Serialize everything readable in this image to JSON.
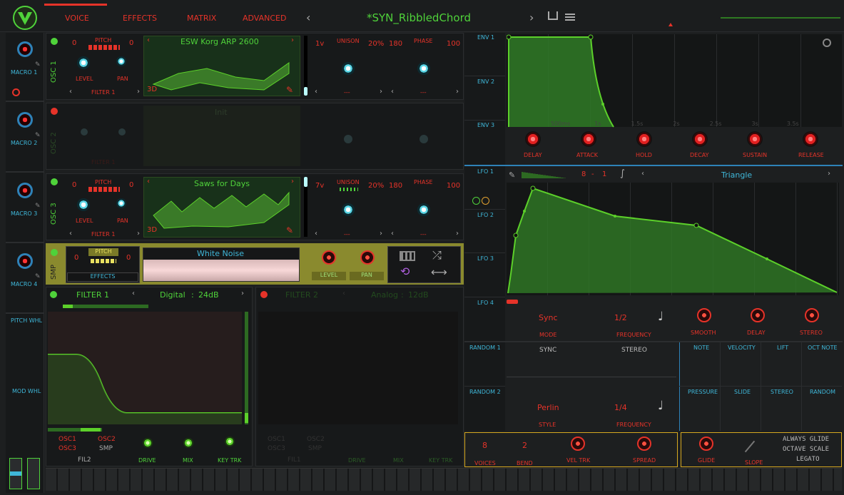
{
  "nav": {
    "tabs": [
      "VOICE",
      "EFFECTS",
      "MATRIX",
      "ADVANCED"
    ],
    "preset": "*SYN_RibbledChord"
  },
  "macros": [
    "MACRO 1",
    "MACRO 2",
    "MACRO 3",
    "MACRO 4"
  ],
  "wheels": {
    "pitch": "PITCH WHL",
    "mod": "MOD WHL"
  },
  "osc": [
    {
      "label": "OSC 1",
      "wave": "ESW Korg ARP 2600",
      "voices": "1v",
      "unison_pct": "20%",
      "unison_val": "180",
      "phase_val": "100",
      "pitch_l": "0",
      "pitch_r": "0",
      "filter": "FILTER 1",
      "dash1": "---",
      "dash2": "---"
    },
    {
      "label": "OSC 2",
      "wave": "Init",
      "filter": "FILTER 1"
    },
    {
      "label": "OSC 3",
      "wave": "Saws for Days",
      "voices": "7v",
      "unison_pct": "20%",
      "unison_val": "180",
      "phase_val": "100",
      "pitch_l": "0",
      "pitch_r": "0",
      "filter": "FILTER 1",
      "dash1": "---",
      "dash2": "---"
    }
  ],
  "osc_labels": {
    "pitch": "PITCH",
    "level": "LEVEL",
    "pan": "PAN",
    "unison": "UNISON",
    "phase": "PHASE",
    "d3": "3D"
  },
  "smp": {
    "label": "SMP",
    "pitch": "PITCH",
    "effects": "EFFECTS",
    "sample": "White Noise",
    "level": "LEVEL",
    "pan": "PAN",
    "l": "0",
    "r": "0"
  },
  "filter1": {
    "name": "FILTER 1",
    "type": "Digital",
    "slope": "24dB",
    "o1": "OSC1",
    "o2": "OSC2",
    "o3": "OSC3",
    "smp": "SMP",
    "fil": "FIL2",
    "drive": "DRIVE",
    "mix": "MIX",
    "keytrk": "KEY TRK"
  },
  "filter2": {
    "name": "FILTER 2",
    "type": "Analog",
    "slope": "12dB",
    "o1": "OSC1",
    "o2": "OSC2",
    "o3": "OSC3",
    "smp": "SMP",
    "fil": "FIL1",
    "drive": "DRIVE",
    "mix": "MIX",
    "keytrk": "KEY TRK"
  },
  "env": {
    "tabs": [
      "ENV 1",
      "ENV 2",
      "ENV 3"
    ],
    "knobs": [
      "DELAY",
      "ATTACK",
      "HOLD",
      "DECAY",
      "SUSTAIN",
      "RELEASE"
    ],
    "time": [
      "500ms",
      "1s",
      "1.5s",
      "2s",
      "2.5s",
      "3s",
      "3.5s"
    ]
  },
  "lfo": {
    "tabs": [
      "LFO 1",
      "LFO 2",
      "LFO 3",
      "LFO 4"
    ],
    "shape": "Triangle",
    "steps": "8",
    "smooth_v": "1",
    "mode": "Sync",
    "mode_l": "MODE",
    "freq": "1/2",
    "freq_l": "FREQUENCY",
    "knobs": [
      "SMOOTH",
      "DELAY",
      "STEREO"
    ]
  },
  "random": {
    "tabs": [
      "RANDOM 1",
      "RANDOM 2"
    ],
    "sync": "SYNC",
    "stereo": "STEREO",
    "style": "Perlin",
    "style_l": "STYLE",
    "freq": "1/4",
    "freq_l": "FREQUENCY"
  },
  "sources": [
    "NOTE",
    "VELOCITY",
    "LIFT",
    "OCT NOTE",
    "PRESSURE",
    "SLIDE",
    "STEREO",
    "RANDOM"
  ],
  "voice": {
    "voices": "8",
    "voices_l": "VOICES",
    "bend": "2",
    "bend_l": "BEND",
    "veltrk": "VEL TRK",
    "spread": "SPREAD"
  },
  "glide": {
    "glide": "GLIDE",
    "slope": "SLOPE",
    "opts": [
      "ALWAYS GLIDE",
      "OCTAVE SCALE",
      "LEGATO"
    ]
  }
}
